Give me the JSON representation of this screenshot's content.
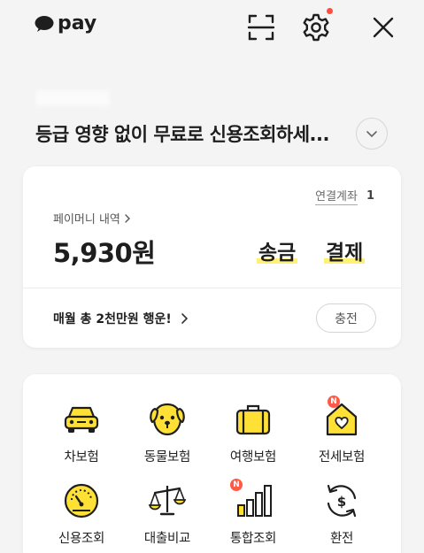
{
  "header": {
    "logo_text": "pay",
    "icons": [
      "scan-icon",
      "settings-icon",
      "close-icon"
    ],
    "notification_dot_color": "#ff4c3b"
  },
  "banner": {
    "headline": "등급 영향 없이 무료로 신용조회하세..."
  },
  "wallet": {
    "linked_accounts_label": "연결계좌",
    "linked_accounts_count": "1",
    "money_history_label": "페이머니 내역",
    "balance": "5,930원",
    "send_label": "송금",
    "pay_label": "결제",
    "promo_text": "매월 총 2천만원 행운!",
    "charge_label": "충전",
    "highlight_color": "#fff176"
  },
  "services": [
    {
      "label": "차보험",
      "icon": "car-icon",
      "badge": ""
    },
    {
      "label": "동물보험",
      "icon": "dog-icon",
      "badge": ""
    },
    {
      "label": "여행보험",
      "icon": "luggage-icon",
      "badge": ""
    },
    {
      "label": "전세보험",
      "icon": "house-heart-icon",
      "badge": "N"
    },
    {
      "label": "신용조회",
      "icon": "gauge-icon",
      "badge": ""
    },
    {
      "label": "대출비교",
      "icon": "scale-icon",
      "badge": ""
    },
    {
      "label": "통합조회",
      "icon": "bar-chart-icon",
      "badge": "N"
    },
    {
      "label": "환전",
      "icon": "exchange-icon",
      "badge": ""
    }
  ],
  "colors": {
    "accent_yellow": "#ffe135",
    "badge_red": "#ff5a47"
  }
}
